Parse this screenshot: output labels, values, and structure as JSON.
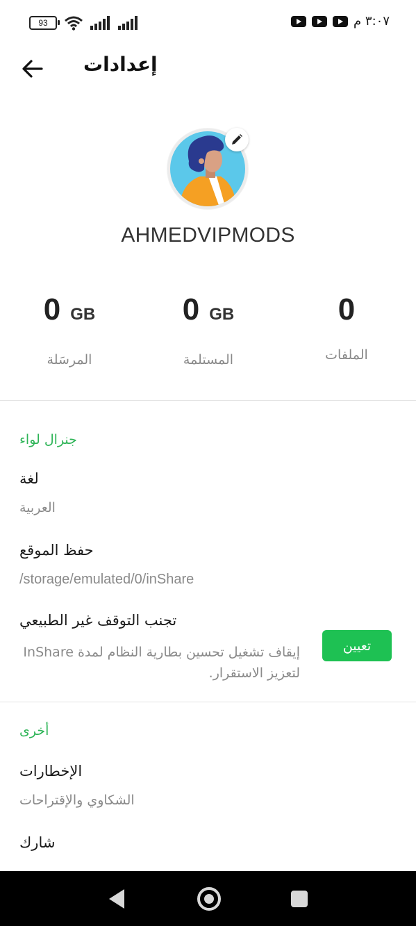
{
  "status_bar": {
    "battery": "93",
    "time": "٣:٠٧ م"
  },
  "header": {
    "title": "إعدادات"
  },
  "profile": {
    "username": "AHMEDVIPMODS"
  },
  "stats": [
    {
      "value": "0",
      "unit": "GB",
      "label": "المرسَلة"
    },
    {
      "value": "0",
      "unit": "GB",
      "label": "المستلمة"
    },
    {
      "value": "0",
      "unit": "",
      "label": "الملفات"
    }
  ],
  "general": {
    "title": "جنرال لواء",
    "language": {
      "title": "لغة",
      "value": "العربية"
    },
    "save_location": {
      "title": "حفظ الموقع",
      "value": "/storage/emulated/0/inShare"
    },
    "avoid_stop": {
      "title": "تجنب التوقف غير الطبيعي",
      "desc_line1": "إيقاف تشغيل تحسين بطارية النظام لمدة InShare",
      "desc_line2": "لتعزيز الاستقرار.",
      "button": "تعيين"
    }
  },
  "other": {
    "title": "أخرى",
    "feedback": {
      "title": "الإخطارات",
      "value": "الشكاوي والإقتراحات"
    },
    "share": {
      "title": "شارك"
    }
  },
  "colors": {
    "accent": "#2eb457",
    "button": "#1ec153"
  }
}
